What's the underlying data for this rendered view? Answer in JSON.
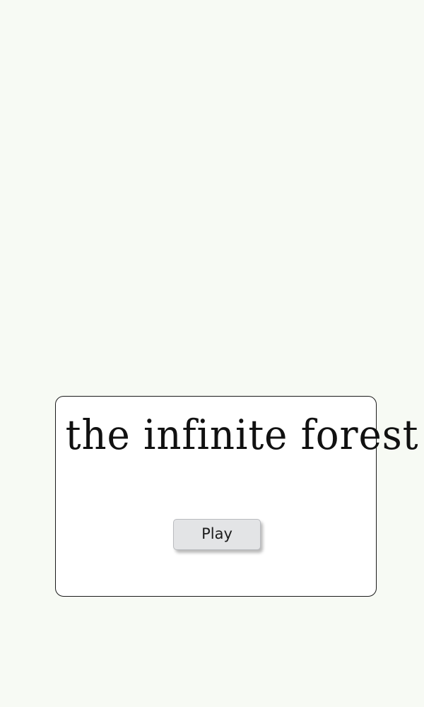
{
  "game": {
    "title": "the infinite forest"
  },
  "menu": {
    "play_label": "Play"
  }
}
